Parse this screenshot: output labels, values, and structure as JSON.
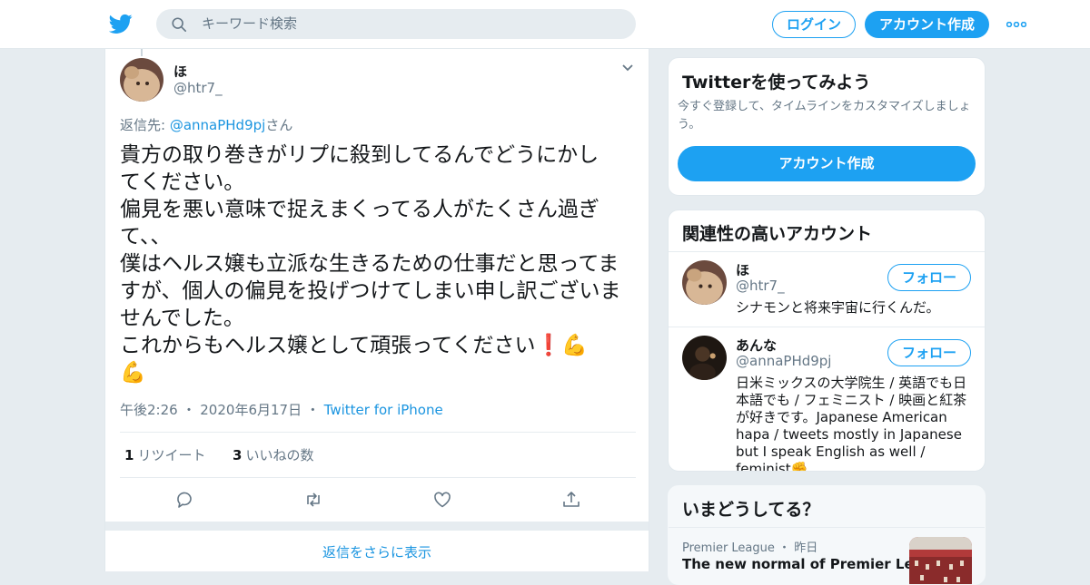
{
  "header": {
    "search_placeholder": "キーワード検索",
    "login_label": "ログイン",
    "signup_label": "アカウント作成"
  },
  "tweet": {
    "name": "ほ",
    "handle": "@htr7_",
    "replying_prefix": "返信先: ",
    "replying_to": "@annaPHd9pj",
    "replying_suffix": "さん",
    "text": "貴方の取り巻きがリプに殺到してるんでどうにかし\nてください。\n偏見を悪い意味で捉えまくってる人がたくさん過ぎ\nて、、\n僕はヘルス嬢も立派な生きるための仕事だと思ってま\nすが、個人の偏見を投げつけてしまい申し訳ございま\nせんでした。\nこれからもヘルス嬢として頑張ってください❗💪\n💪",
    "time": "午後2:26",
    "date": "2020年6月17日",
    "source": "Twitter for iPhone",
    "retweet_count": "1",
    "retweet_label": "リツイート",
    "like_count": "3",
    "like_label": "いいねの数",
    "show_more_replies": "返信をさらに表示"
  },
  "sidebar": {
    "try_title": "Twitterを使ってみよう",
    "try_desc": "今すぐ登録して、タイムラインをカスタマイズしましょう。",
    "try_button": "アカウント作成",
    "related_title": "関連性の高いアカウント",
    "accounts": [
      {
        "name": "ほ",
        "handle": "@htr7_",
        "bio": "シナモンと将来宇宙に行くんだ。",
        "follow_label": "フォロー"
      },
      {
        "name": "あんな",
        "handle": "@annaPHd9pj",
        "bio": "日米ミックスの大学院生 / 英語でも日本語でも / フェミニスト / 映画と紅茶が好きです。Japanese American hapa / tweets mostly in Japanese but I speak English as well / feminist✊",
        "follow_label": "フォロー"
      }
    ],
    "trends_title": "いまどうしてる？",
    "trend": {
      "source": "Premier League",
      "time": "昨日",
      "title": "The new normal of Premier League"
    }
  },
  "colors": {
    "accent": "#1da1f2",
    "link": "#1b95e0",
    "muted": "#657786",
    "background": "#e6ecf0"
  },
  "icons": [
    "twitter-logo-icon",
    "search-icon",
    "more-dots-icon",
    "chevron-down-icon",
    "reply-icon",
    "retweet-icon",
    "like-icon",
    "share-icon"
  ]
}
